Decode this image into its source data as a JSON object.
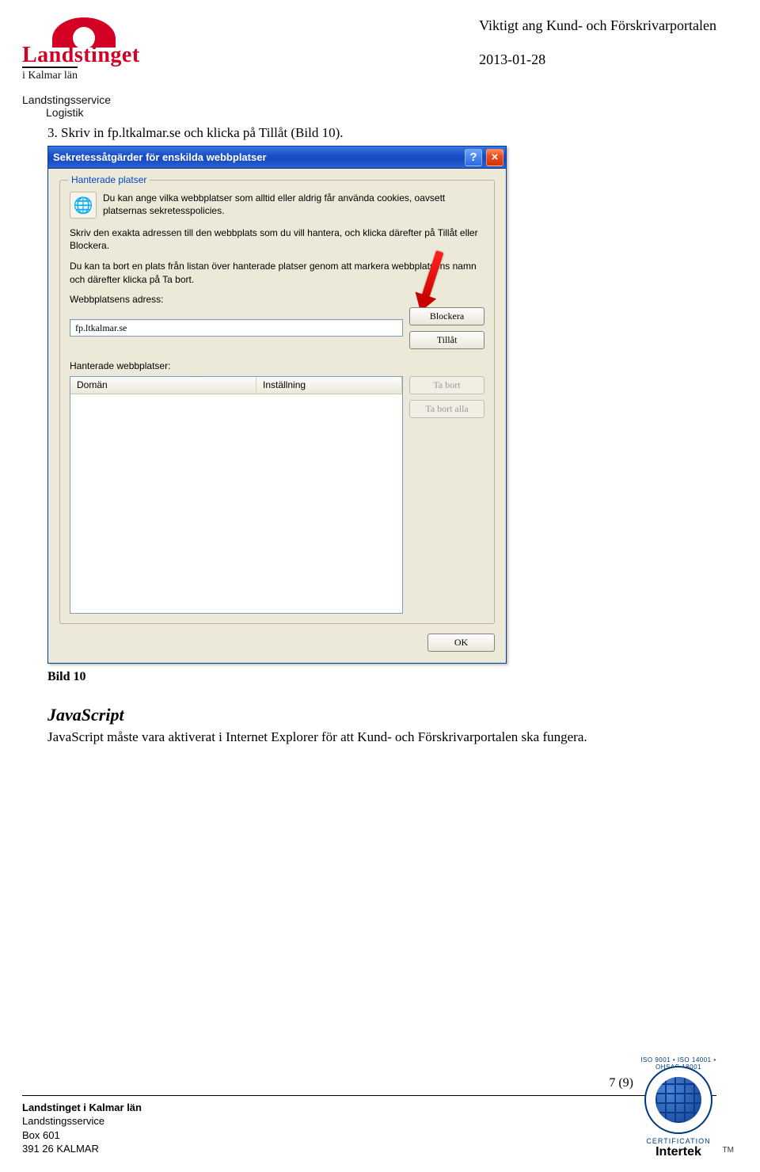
{
  "header": {
    "logo_word": "Landstinget",
    "logo_sub": "i Kalmar län",
    "dept1": "Landstingsservice",
    "dept2": "Logistik",
    "doc_title": "Viktigt ang Kund- och Förskrivarportalen",
    "date": "2013-01-28"
  },
  "content": {
    "instruction": "3.  Skriv in fp.ltkalmar.se och klicka på Tillåt (Bild 10).",
    "caption": "Bild 10",
    "js_heading": "JavaScript",
    "js_body": "JavaScript måste vara aktiverat i Internet Explorer för att Kund- och Förskrivarportalen ska fungera."
  },
  "dialog": {
    "title": "Sekretessåtgärder för enskilda webbplatser",
    "group_title": "Hanterade platser",
    "intro": "Du kan ange vilka webbplatser som alltid eller aldrig får använda cookies, oavsett platsernas sekretesspolicies.",
    "para1": "Skriv den exakta adressen till den webbplats som du vill hantera, och klicka därefter på Tillåt eller Blockera.",
    "para2": "Du kan ta bort en plats från listan över hanterade platser genom att markera webbplatsens namn och därefter klicka på Ta bort.",
    "address_label": "Webbplatsens adress:",
    "address_value": "fp.ltkalmar.se",
    "btn_block": "Blockera",
    "btn_allow": "Tillåt",
    "managed_label": "Hanterade webbplatser:",
    "col_domain": "Domän",
    "col_setting": "Inställning",
    "btn_remove": "Ta bort",
    "btn_remove_all": "Ta bort alla",
    "btn_ok": "OK",
    "help_glyph": "?",
    "close_glyph": "×"
  },
  "footer": {
    "page": "7 (9)",
    "line1": "Landstinget i Kalmar län",
    "line2": "Landstingsservice",
    "line3": "Box 601",
    "line4": "391 26 KALMAR",
    "cert_ring_text": "ISO 9001 • ISO 14001 • OHSAS 18001",
    "cert_label": "CERTIFICATION",
    "cert_name": "Intertek",
    "tm": "TM"
  }
}
